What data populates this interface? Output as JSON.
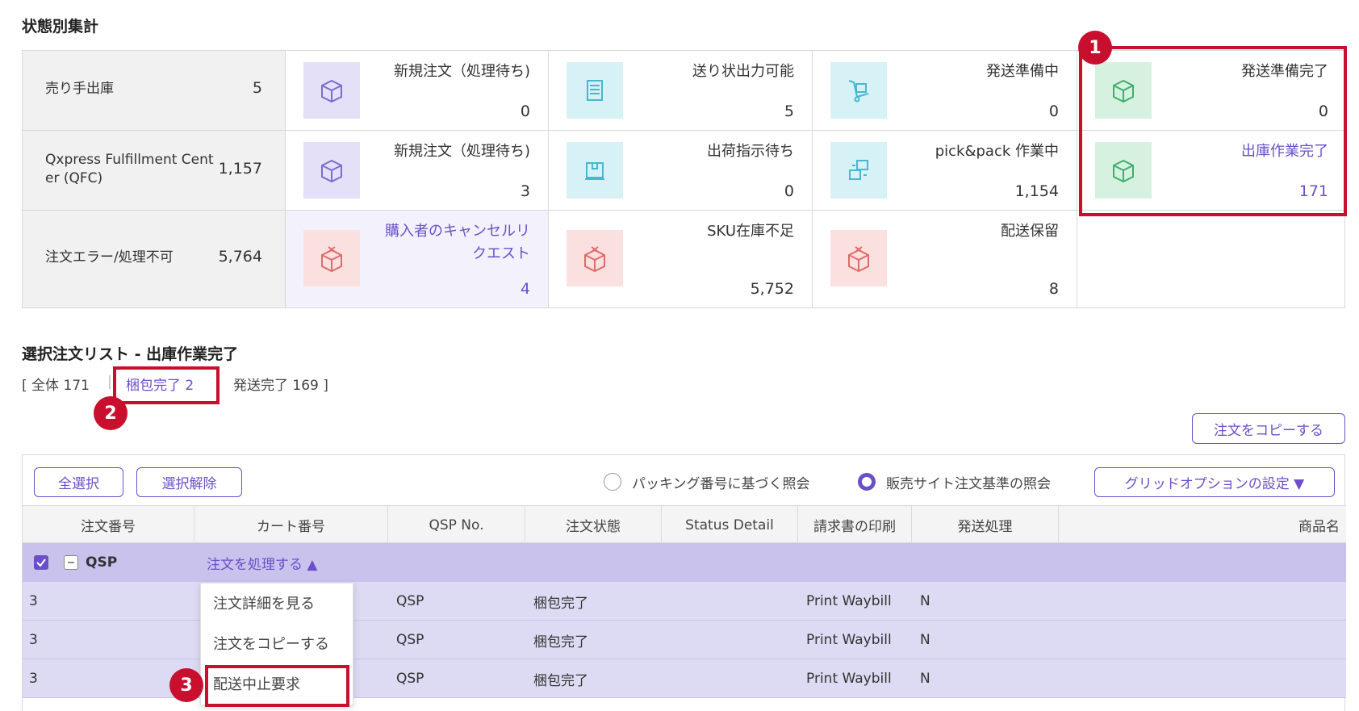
{
  "summary": {
    "title": "状態別集計",
    "rows": [
      {
        "label": "売り手出庫",
        "count": "5",
        "cells": [
          {
            "title": "新規注文（処理待ち)",
            "count": "0"
          },
          {
            "title": "送り状出力可能",
            "count": "5"
          },
          {
            "title": "発送準備中",
            "count": "0"
          },
          {
            "title": "発送準備完了",
            "count": "0"
          }
        ]
      },
      {
        "label": "Qxpress Fulfillment Cent\ner (QFC)",
        "label_line1": "Qxpress Fulfillment Cent",
        "label_line2": "er (QFC)",
        "count": "1,157",
        "cells": [
          {
            "title": "新規注文（処理待ち)",
            "count": "3"
          },
          {
            "title": "出荷指示待ち",
            "count": "0"
          },
          {
            "title": "pick&pack 作業中",
            "count": "1,154"
          },
          {
            "title": "出庫作業完了",
            "count": "171"
          }
        ]
      },
      {
        "label": "注文エラー/処理不可",
        "count": "5,764",
        "cells": [
          {
            "title_line1": "購入者のキャンセルリ",
            "title_line2": "クエスト",
            "count": "4"
          },
          {
            "title": "SKU在庫不足",
            "count": "5,752"
          },
          {
            "title": "配送保留",
            "count": "8"
          }
        ]
      }
    ]
  },
  "order_list": {
    "title": "選択注文リスト - 出庫作業完了",
    "filter": {
      "all": "[ 全体 171",
      "packed": "梱包完了 2",
      "shipped": "発送完了 169 ]"
    },
    "copy_button": "注文をコピーする",
    "select_all": "全選択",
    "deselect": "選択解除",
    "radio_packing": "パッキング番号に基づく照会",
    "radio_site": "販売サイト注文基準の照会",
    "grid_options": "グリッドオプションの設定 ▼",
    "columns": [
      "注文番号",
      "カート番号",
      "QSP No.",
      "注文状態",
      "Status Detail",
      "請求書の印刷",
      "発送処理",
      "商品名"
    ],
    "group_row": {
      "label": "QSP",
      "action": "注文を処理する ▲"
    },
    "rows": [
      {
        "order": "3",
        "qsp": "QSP",
        "status": "梱包完了",
        "invoice": "Print Waybill",
        "ship": "N"
      },
      {
        "order": "3",
        "qsp": "QSP",
        "status": "梱包完了",
        "invoice": "Print Waybill",
        "ship": "N"
      },
      {
        "order": "3",
        "qsp": "QSP",
        "status": "梱包完了",
        "invoice": "Print Waybill",
        "ship": "N"
      }
    ],
    "dropdown": [
      "注文詳細を見る",
      "注文をコピーする",
      "配送中止要求"
    ]
  },
  "badges": [
    "1",
    "2",
    "3"
  ],
  "colors": {
    "accent": "#6b4fc9",
    "highlight": "#c8102e"
  }
}
